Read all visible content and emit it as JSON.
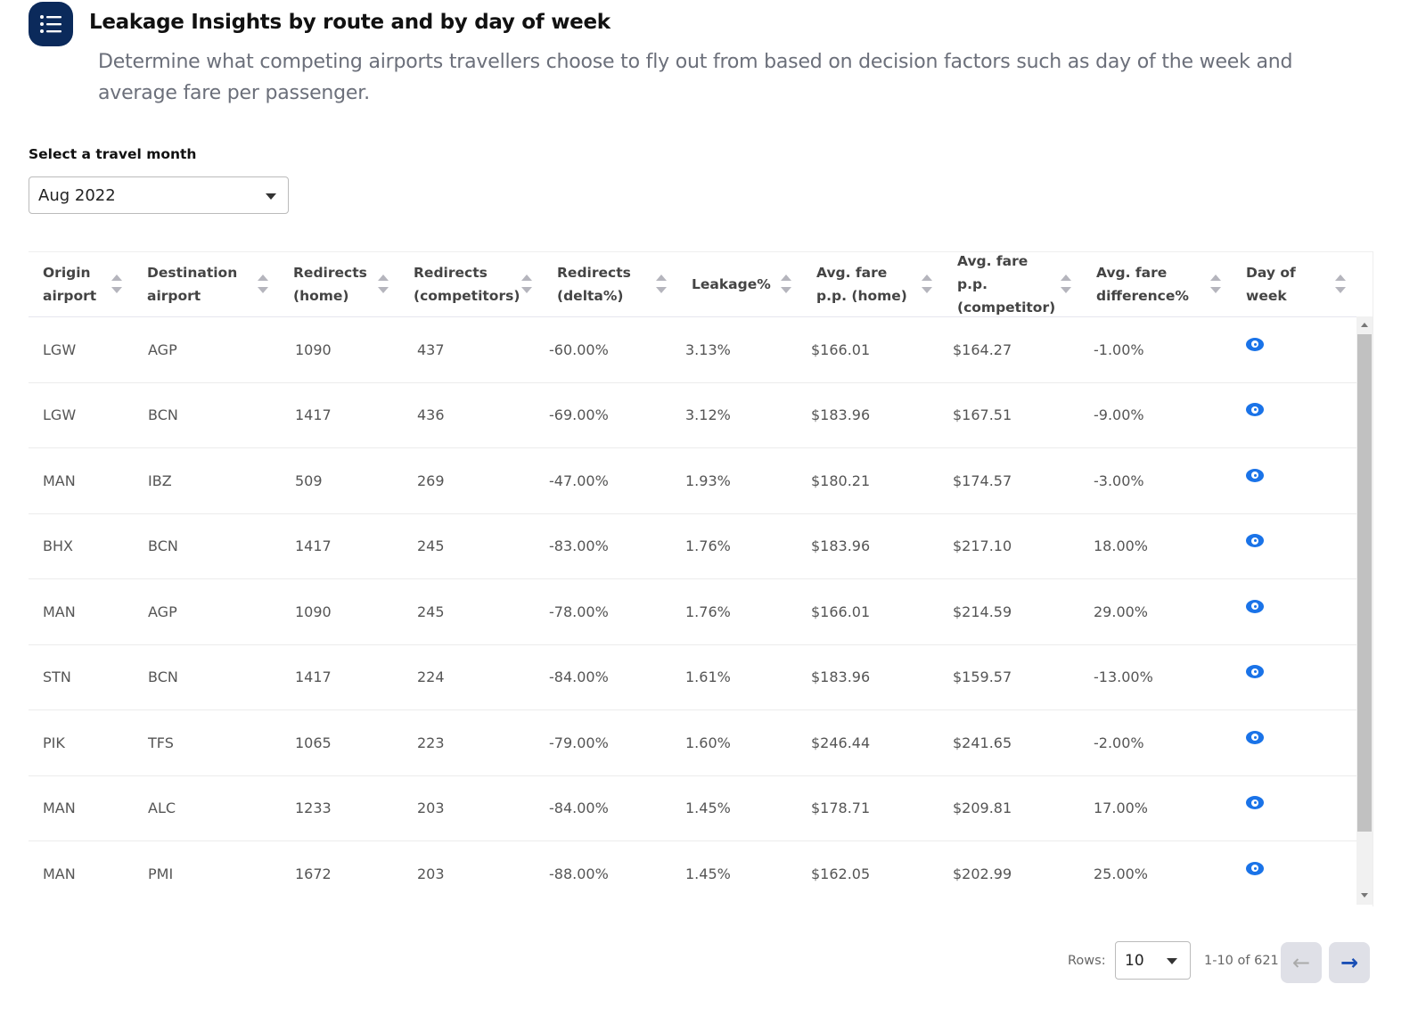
{
  "header": {
    "icon": "list-icon",
    "title": "Leakage Insights by route and by day of week",
    "subtitle": "Determine what competing airports travellers choose to fly out from based on decision factors such as day of the week and average fare per passenger."
  },
  "month_select": {
    "label": "Select a travel month",
    "value": "Aug 2022"
  },
  "table": {
    "columns": [
      "Origin airport",
      "Destination airport",
      "Redirects (home)",
      "Redirects (competitors)",
      "Redirects (delta%)",
      "Leakage%",
      "Avg. fare p.p. (home)",
      "Avg. fare p.p. (competitor)",
      "Avg. fare difference%",
      "Day of week"
    ],
    "rows": [
      [
        "LGW",
        "AGP",
        "1090",
        "437",
        "-60.00%",
        "3.13%",
        "$166.01",
        "$164.27",
        "-1.00%"
      ],
      [
        "LGW",
        "BCN",
        "1417",
        "436",
        "-69.00%",
        "3.12%",
        "$183.96",
        "$167.51",
        "-9.00%"
      ],
      [
        "MAN",
        "IBZ",
        "509",
        "269",
        "-47.00%",
        "1.93%",
        "$180.21",
        "$174.57",
        "-3.00%"
      ],
      [
        "BHX",
        "BCN",
        "1417",
        "245",
        "-83.00%",
        "1.76%",
        "$183.96",
        "$217.10",
        "18.00%"
      ],
      [
        "MAN",
        "AGP",
        "1090",
        "245",
        "-78.00%",
        "1.76%",
        "$166.01",
        "$214.59",
        "29.00%"
      ],
      [
        "STN",
        "BCN",
        "1417",
        "224",
        "-84.00%",
        "1.61%",
        "$183.96",
        "$159.57",
        "-13.00%"
      ],
      [
        "PIK",
        "TFS",
        "1065",
        "223",
        "-79.00%",
        "1.60%",
        "$246.44",
        "$241.65",
        "-2.00%"
      ],
      [
        "MAN",
        "ALC",
        "1233",
        "203",
        "-84.00%",
        "1.45%",
        "$178.71",
        "$209.81",
        "17.00%"
      ],
      [
        "MAN",
        "PMI",
        "1672",
        "203",
        "-88.00%",
        "1.45%",
        "$162.05",
        "$202.99",
        "25.00%"
      ]
    ],
    "day_of_week_icon": "eye-icon"
  },
  "pagination": {
    "rows_label": "Rows:",
    "rows_value": "10",
    "range": "1-10 of 621",
    "prev_icon": "arrow-left-icon",
    "next_icon": "arrow-right-icon"
  },
  "colors": {
    "brand": "#0b2a5b",
    "accent": "#1a73e8"
  }
}
